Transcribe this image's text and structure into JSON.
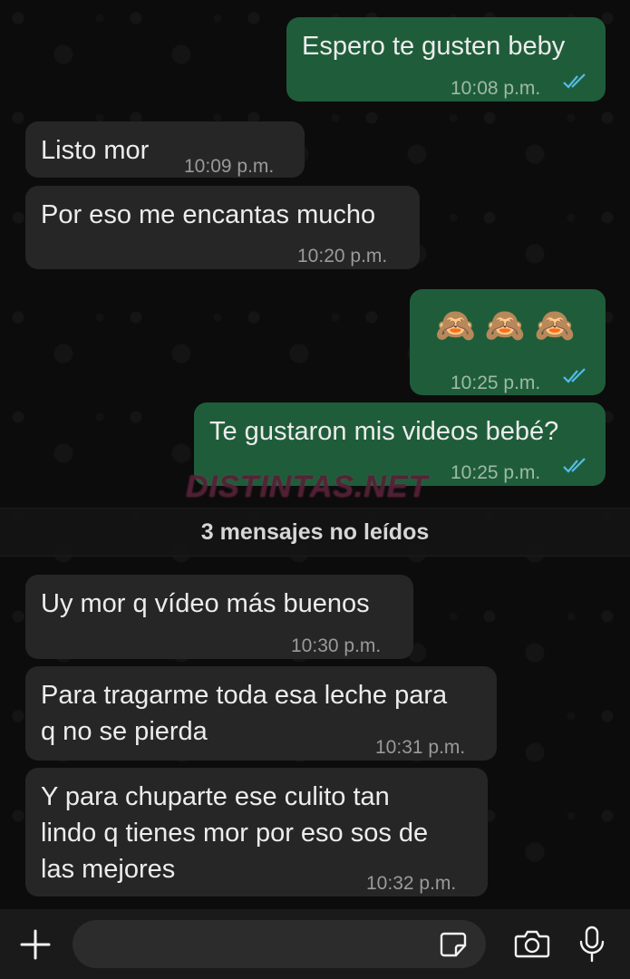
{
  "messages": [
    {
      "id": "m1",
      "direction": "outgoing",
      "text": "Espero te gusten beby",
      "time": "10:08 p.m.",
      "read": true
    },
    {
      "id": "m2",
      "direction": "incoming",
      "text": "Listo mor",
      "time": "10:09 p.m."
    },
    {
      "id": "m3",
      "direction": "incoming",
      "text": "Por eso me encantas mucho",
      "time": "10:20 p.m."
    },
    {
      "id": "m4",
      "direction": "outgoing",
      "text": "🙈 🙈 🙈",
      "time": "10:25 p.m.",
      "read": true
    },
    {
      "id": "m5",
      "direction": "outgoing",
      "text": "Te gustaron mis videos bebé?",
      "time": "10:25 p.m.",
      "read": true
    },
    {
      "id": "m6",
      "direction": "incoming",
      "text": "Uy mor q vídeo más buenos",
      "time": "10:30 p.m."
    },
    {
      "id": "m7",
      "direction": "incoming",
      "text": "Para tragarme toda esa leche para\nq no se pierda",
      "time": "10:31 p.m."
    },
    {
      "id": "m8",
      "direction": "incoming",
      "text": "Y para chuparte ese culito tan\nlindo q tienes mor por eso sos de\nlas mejores",
      "time": "10:32 p.m."
    }
  ],
  "unread_divider": "3 mensajes no leídos",
  "watermark": "DISTINTAS.NET",
  "composer": {
    "placeholder": "",
    "icons": [
      "plus-icon",
      "sticker-icon",
      "camera-icon",
      "microphone-icon"
    ]
  },
  "colors": {
    "outgoing_bubble": "#1f5d3a",
    "incoming_bubble": "#262626",
    "read_ticks": "#53bdeb"
  }
}
